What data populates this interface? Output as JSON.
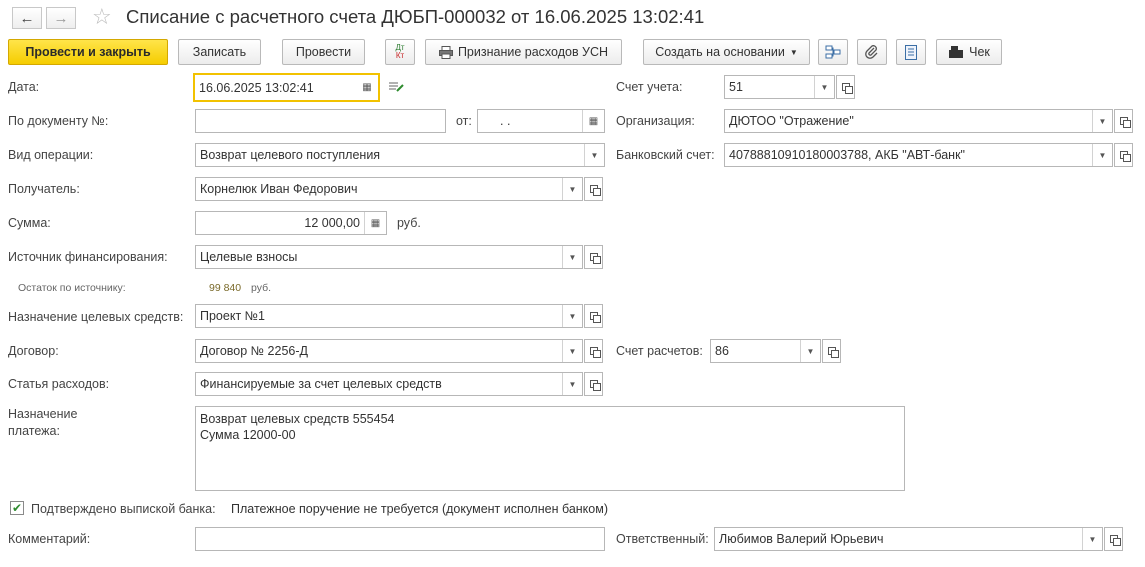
{
  "header": {
    "title": "Списание с расчетного счета ДЮБП-000032 от 16.06.2025 13:02:41",
    "back_icon": "←",
    "forward_icon": "→",
    "star_icon": "☆"
  },
  "toolbar": {
    "post_close": "Провести и закрыть",
    "save": "Записать",
    "post": "Провести",
    "dtkt_top": "Дт",
    "dtkt_bottom": "Кт",
    "usn": "Признание расходов УСН",
    "create_based": "Создать на основании",
    "receipt": "Чек"
  },
  "labels": {
    "date": "Дата:",
    "doc_no": "По документу №:",
    "from": "от:",
    "op_type": "Вид операции:",
    "recipient": "Получатель:",
    "sum": "Сумма:",
    "currency": "руб.",
    "funding": "Источник финансирования:",
    "remaining": "Остаток по источнику:",
    "remaining_value": "99 840",
    "remaining_currency": "руб.",
    "purpose_funds": "Назначение целевых средств:",
    "contract": "Договор:",
    "expense_item": "Статья расходов:",
    "payment_purpose_1": "Назначение",
    "payment_purpose_2": "платежа:",
    "account": "Счет учета:",
    "org": "Организация:",
    "bank_acc": "Банковский счет:",
    "settle_acc": "Счет расчетов:",
    "confirmed": "Подтверждено выпиской банка:",
    "confirmed_note": "Платежное поручение не требуется (документ исполнен банком)",
    "comment": "Комментарий:",
    "responsible": "Ответственный:"
  },
  "fields": {
    "date": "16.06.2025 13:02:41",
    "doc_no": "",
    "from_date": " .  .",
    "op_type": "Возврат целевого поступления",
    "recipient": "Корнелюк Иван Федорович",
    "sum": "12 000,00",
    "funding": "Целевые взносы",
    "purpose_funds": "Проект №1",
    "contract": "Договор № 2256-Д",
    "expense_item": "Финансируемые за счет целевых средств",
    "payment_purpose_line1": "Возврат целевых средств 555454",
    "payment_purpose_line2": "Сумма 12000-00",
    "account": "51",
    "org": "ДЮТОО \"Отражение\"",
    "bank_acc": "40788810910180003788, АКБ \"АВТ-банк\"",
    "settle_acc": "86",
    "comment": "",
    "responsible": "Любимов Валерий Юрьевич",
    "confirmed": true
  }
}
